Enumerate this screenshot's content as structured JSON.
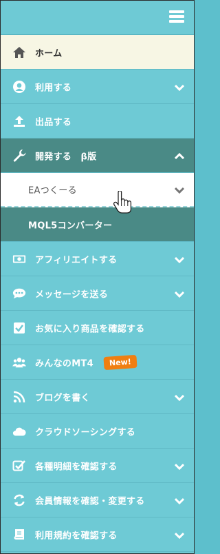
{
  "menu": {
    "items": [
      {
        "label": "ホーム",
        "icon": "home-icon"
      },
      {
        "label": "利用する",
        "icon": "user-circle-icon"
      },
      {
        "label": "出品する",
        "icon": "upload-icon"
      },
      {
        "label": "開発する　β版",
        "icon": "wrench-icon"
      },
      {
        "label": "EAつくーる",
        "icon": "none"
      },
      {
        "label": "MQL5コンバーター",
        "icon": "none"
      },
      {
        "label": "アフィリエイトする",
        "icon": "money-icon"
      },
      {
        "label": "メッセージを送る",
        "icon": "chat-icon"
      },
      {
        "label": "お気に入り商品を確認する",
        "icon": "checkbox-icon"
      },
      {
        "label": "みんなのMT4",
        "icon": "users-icon",
        "badge": "New!"
      },
      {
        "label": "ブログを書く",
        "icon": "rss-icon"
      },
      {
        "label": "クラウドソーシングする",
        "icon": "cloud-icon"
      },
      {
        "label": "各種明細を確認する",
        "icon": "check-square-icon"
      },
      {
        "label": "会員情報を確認・変更する",
        "icon": "refresh-icon"
      },
      {
        "label": "利用規約を確認する",
        "icon": "book-icon"
      }
    ]
  },
  "colors": {
    "teal": "#6ecad5",
    "dark_teal": "#4a8a86",
    "home_bg": "#f7f6e4",
    "badge": "#f07f11"
  }
}
